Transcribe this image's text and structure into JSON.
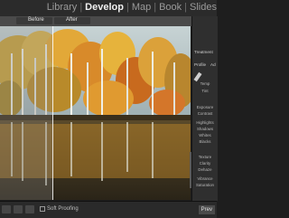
{
  "modules": {
    "items": [
      {
        "label": "Library",
        "active": false
      },
      {
        "label": "Develop",
        "active": true
      },
      {
        "label": "Map",
        "active": false
      },
      {
        "label": "Book",
        "active": false
      },
      {
        "label": "Slides",
        "active": false
      }
    ],
    "separator": "|"
  },
  "view": {
    "before_label": "Before",
    "after_label": "After"
  },
  "right_panel": {
    "section_title": "Treatment",
    "profile_label": "Profile",
    "profile_value": "Ad",
    "temp_label": "Temp",
    "tint_label": "Tint",
    "exposure_label": "Exposure",
    "contrast_label": "Contrast",
    "highlights_label": "Highlights",
    "shadows_label": "Shadows",
    "whites_label": "Whites",
    "blacks_label": "Blacks",
    "texture_label": "Texture",
    "clarity_label": "Clarity",
    "dehaze_label": "Dehaze",
    "vibrance_label": "Vibrance",
    "saturation_label": "Saturation"
  },
  "bottom": {
    "soft_proofing_label": "Soft Proofing",
    "previous_label": "Prev"
  },
  "colors": {
    "accent": "#f0f0f0",
    "panel_bg": "#2f2f2f",
    "sky": "#b9c9cc"
  }
}
